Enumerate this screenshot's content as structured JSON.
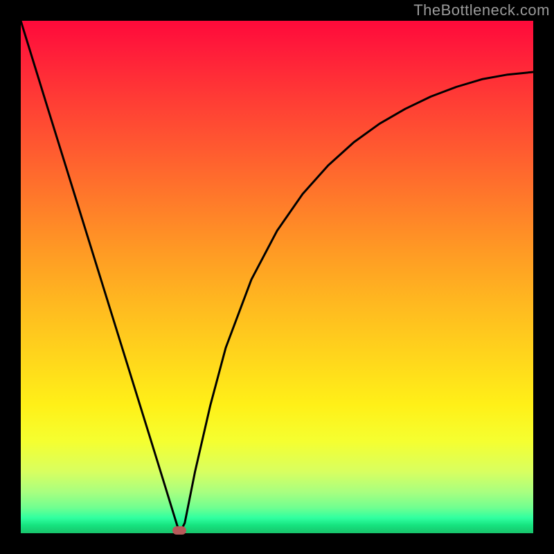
{
  "watermark": "TheBottleneck.com",
  "chart_data": {
    "type": "line",
    "title": "",
    "xlabel": "",
    "ylabel": "",
    "xlim": [
      0,
      1
    ],
    "ylim": [
      0,
      1
    ],
    "minimum": {
      "x": 0.31,
      "y": 0.0
    },
    "series": [
      {
        "name": "curve",
        "x": [
          0.0,
          0.05,
          0.1,
          0.15,
          0.2,
          0.25,
          0.28,
          0.3,
          0.31,
          0.32,
          0.34,
          0.37,
          0.4,
          0.45,
          0.5,
          0.55,
          0.6,
          0.65,
          0.7,
          0.75,
          0.8,
          0.85,
          0.9,
          0.95,
          1.0
        ],
        "values": [
          1.0,
          0.838,
          0.677,
          0.516,
          0.355,
          0.194,
          0.097,
          0.032,
          0.0,
          0.02,
          0.12,
          0.25,
          0.362,
          0.495,
          0.59,
          0.662,
          0.718,
          0.763,
          0.799,
          0.828,
          0.852,
          0.871,
          0.886,
          0.895,
          0.9
        ]
      }
    ],
    "marker": {
      "x": 0.31,
      "y": 0.005,
      "color": "#b75a5a"
    },
    "gradient_bands": [
      {
        "color": "#ff0a3a",
        "stop": 0.0
      },
      {
        "color": "#ff7a2a",
        "stop": 0.35
      },
      {
        "color": "#ffd41c",
        "stop": 0.65
      },
      {
        "color": "#f5ff30",
        "stop": 0.82
      },
      {
        "color": "#18c36b",
        "stop": 1.0
      }
    ]
  }
}
